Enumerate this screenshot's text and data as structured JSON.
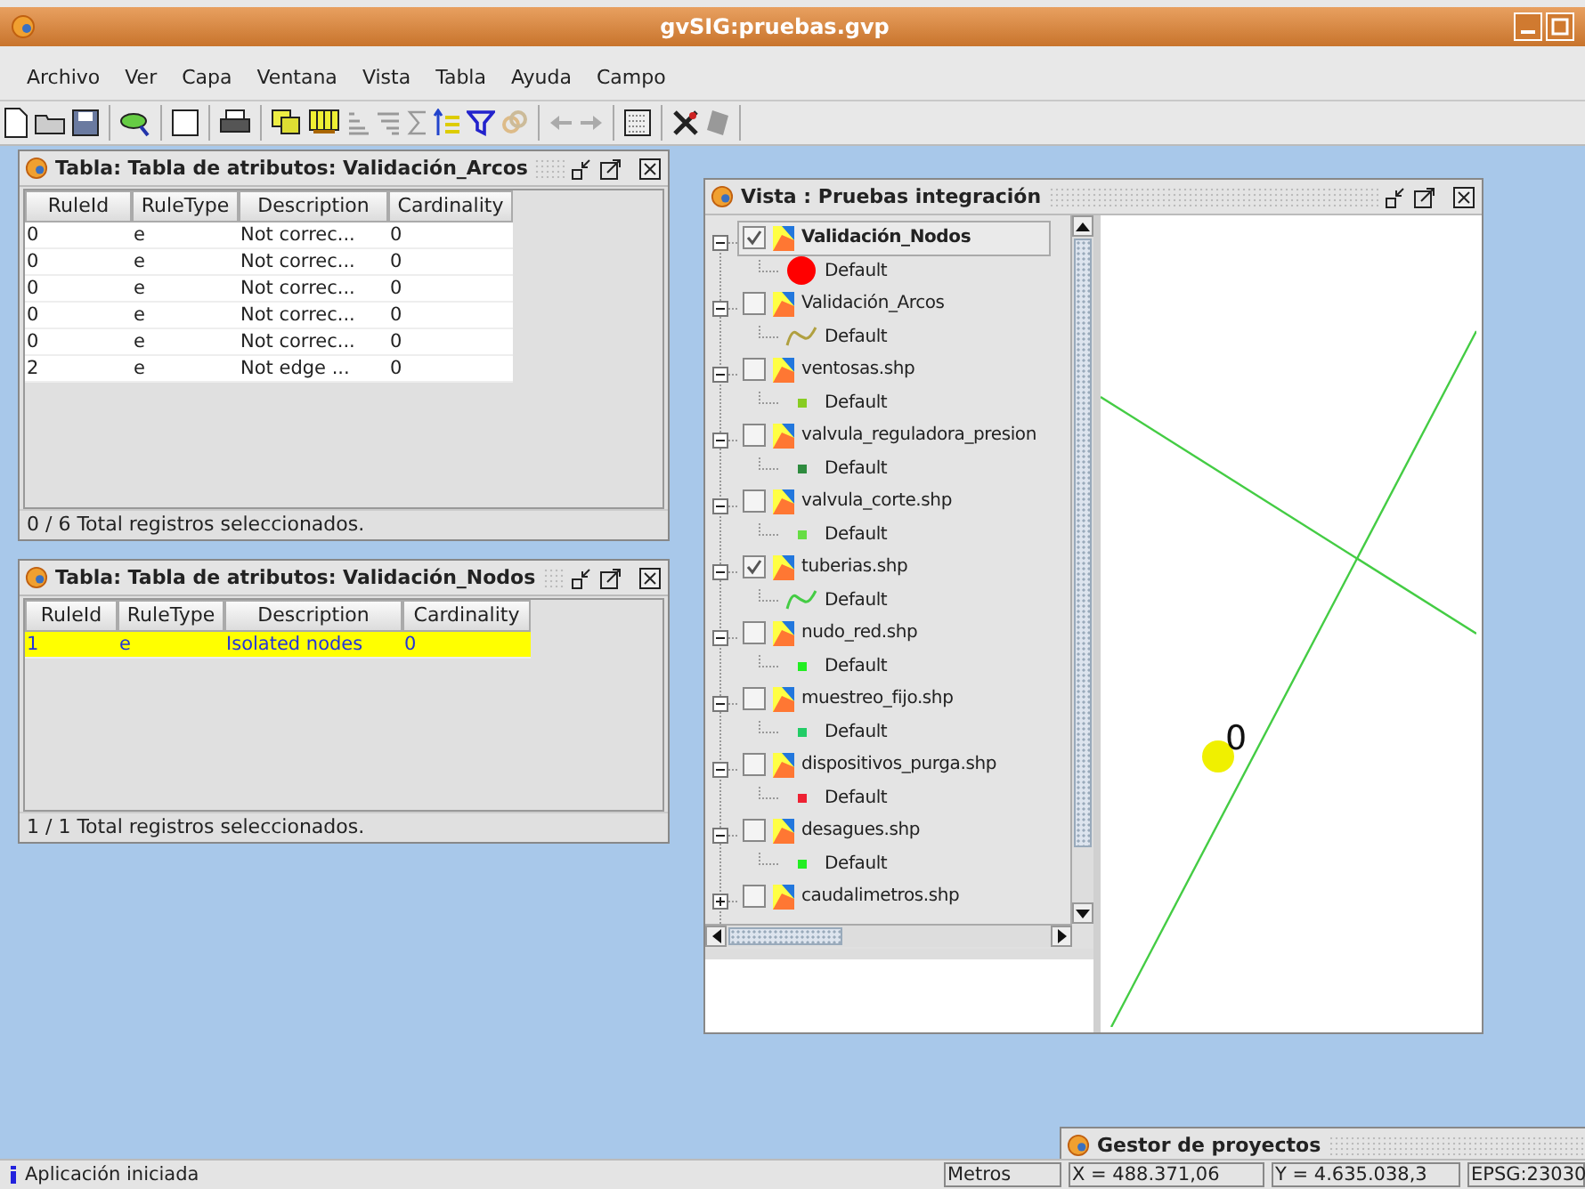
{
  "window": {
    "title": "gvSIG:pruebas.gvp"
  },
  "menu": [
    "Archivo",
    "Ver",
    "Capa",
    "Ventana",
    "Vista",
    "Tabla",
    "Ayuda",
    "Campo"
  ],
  "tables": [
    {
      "title": "Tabla: Tabla de atributos: Validación_Arcos",
      "columns": [
        "RuleId",
        "RuleType",
        "Description",
        "Cardinality"
      ],
      "rows": [
        {
          "cells": [
            "0",
            "e",
            "Not correc...",
            "0"
          ],
          "selected": false
        },
        {
          "cells": [
            "0",
            "e",
            "Not correc...",
            "0"
          ],
          "selected": false
        },
        {
          "cells": [
            "0",
            "e",
            "Not correc...",
            "0"
          ],
          "selected": false
        },
        {
          "cells": [
            "0",
            "e",
            "Not correc...",
            "0"
          ],
          "selected": false
        },
        {
          "cells": [
            "0",
            "e",
            "Not correc...",
            "0"
          ],
          "selected": false
        },
        {
          "cells": [
            "2",
            "e",
            "Not edge ...",
            "0"
          ],
          "selected": false
        }
      ],
      "footer": "0 / 6 Total registros seleccionados."
    },
    {
      "title": "Tabla: Tabla de atributos: Validación_Nodos",
      "columns": [
        "RuleId",
        "RuleType",
        "Description",
        "Cardinality"
      ],
      "rows": [
        {
          "cells": [
            "1",
            "e",
            "Isolated nodes",
            "0"
          ],
          "selected": true
        }
      ],
      "footer": "1 / 1 Total registros seleccionados."
    }
  ],
  "view": {
    "title": "Vista : Pruebas integración",
    "layers": [
      {
        "name": "Validación_Nodos",
        "checked": true,
        "selected": true,
        "expanded": true,
        "legend": {
          "kind": "point",
          "color": "#ff0000",
          "label": "Default"
        }
      },
      {
        "name": "Validación_Arcos",
        "checked": false,
        "selected": false,
        "expanded": true,
        "legend": {
          "kind": "line",
          "color": "#b0a040",
          "label": "Default"
        }
      },
      {
        "name": "ventosas.shp",
        "checked": false,
        "selected": false,
        "expanded": true,
        "legend": {
          "kind": "square",
          "color": "#88cc22",
          "label": "Default"
        }
      },
      {
        "name": "valvula_reguladora_presion",
        "checked": false,
        "selected": false,
        "expanded": true,
        "legend": {
          "kind": "square",
          "color": "#2e8b3e",
          "label": "Default"
        }
      },
      {
        "name": "valvula_corte.shp",
        "checked": false,
        "selected": false,
        "expanded": true,
        "legend": {
          "kind": "square",
          "color": "#66dd44",
          "label": "Default"
        }
      },
      {
        "name": "tuberias.shp",
        "checked": true,
        "selected": false,
        "expanded": true,
        "legend": {
          "kind": "line",
          "color": "#44cc44",
          "label": "Default"
        }
      },
      {
        "name": "nudo_red.shp",
        "checked": false,
        "selected": false,
        "expanded": true,
        "legend": {
          "kind": "square",
          "color": "#22ee22",
          "label": "Default"
        }
      },
      {
        "name": "muestreo_fijo.shp",
        "checked": false,
        "selected": false,
        "expanded": true,
        "legend": {
          "kind": "square",
          "color": "#22cc66",
          "label": "Default"
        }
      },
      {
        "name": "dispositivos_purga.shp",
        "checked": false,
        "selected": false,
        "expanded": true,
        "legend": {
          "kind": "square",
          "color": "#ee2233",
          "label": "Default"
        }
      },
      {
        "name": "desagues.shp",
        "checked": false,
        "selected": false,
        "expanded": true,
        "legend": {
          "kind": "square",
          "color": "#22ee22",
          "label": "Default"
        }
      },
      {
        "name": "caudalimetros.shp",
        "checked": false,
        "selected": false,
        "expanded": false
      }
    ],
    "map_label": "0"
  },
  "project_manager": {
    "title": "Gestor de proyectos"
  },
  "status_bar": {
    "message": "Aplicación iniciada",
    "units": "Metros",
    "x": "X = 488.371,06",
    "y": "Y = 4.635.038,3",
    "crs": "EPSG:23030"
  }
}
